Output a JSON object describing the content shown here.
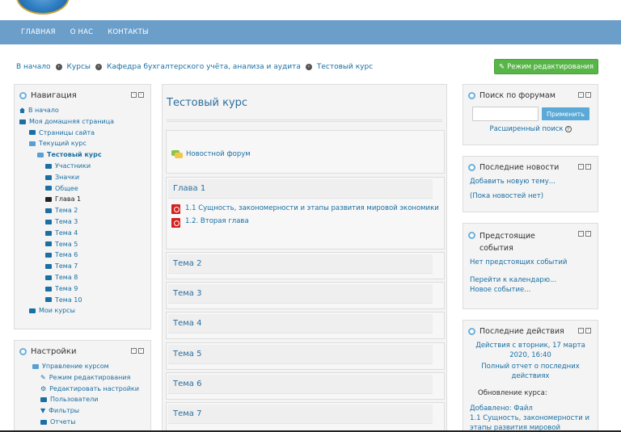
{
  "navbar": {
    "items": [
      "ГЛАВНАЯ",
      "О НАС",
      "КОНТАКТЫ"
    ]
  },
  "breadcrumb": [
    "В начало",
    "Курсы",
    "Кафедра бухгалтерского учёта, анализа и аудита",
    "Тестовый курс"
  ],
  "edit_button": "Режим редактирования",
  "navigation": {
    "title": "Навигация",
    "items": [
      {
        "label": "В начало",
        "icon": "home"
      },
      {
        "label": "Моя домашняя страница",
        "icon": "folder"
      },
      {
        "label": "Страницы сайта",
        "icon": "folder"
      },
      {
        "label": "Текущий курс",
        "icon": "folder-open"
      },
      {
        "label": "Тестовый курс",
        "icon": "folder-open"
      },
      {
        "label": "Участники",
        "icon": "folder"
      },
      {
        "label": "Значки",
        "icon": "folder"
      },
      {
        "label": "Общее",
        "icon": "folder"
      },
      {
        "label": "Глава 1",
        "icon": "folder-dark"
      },
      {
        "label": "Тема 2",
        "icon": "folder"
      },
      {
        "label": "Тема 3",
        "icon": "folder"
      },
      {
        "label": "Тема 4",
        "icon": "folder"
      },
      {
        "label": "Тема 5",
        "icon": "folder"
      },
      {
        "label": "Тема 6",
        "icon": "folder"
      },
      {
        "label": "Тема 7",
        "icon": "folder"
      },
      {
        "label": "Тема 8",
        "icon": "folder"
      },
      {
        "label": "Тема 9",
        "icon": "folder"
      },
      {
        "label": "Тема 10",
        "icon": "folder"
      },
      {
        "label": "Мои курсы",
        "icon": "folder"
      }
    ]
  },
  "settings": {
    "title": "Настройки",
    "items": [
      {
        "label": "Управление курсом",
        "icon": "folder-open"
      },
      {
        "label": "Режим редактирования",
        "icon": "pencil"
      },
      {
        "label": "Редактировать настройки",
        "icon": "gears"
      },
      {
        "label": "Пользователи",
        "icon": "folder"
      },
      {
        "label": "Фильтры",
        "icon": "filter"
      },
      {
        "label": "Отчеты",
        "icon": "folder"
      }
    ]
  },
  "course": {
    "title": "Тестовый курс",
    "news_forum": "Новостной форум",
    "sections": [
      "Глава 1",
      "Тема 2",
      "Тема 3",
      "Тема 4",
      "Тема 5",
      "Тема 6",
      "Тема 7"
    ],
    "chapter1_items": [
      "1.1 Сущность, закономерности и этапы развития мировой экономики",
      "1.2. Вторая глава"
    ]
  },
  "forum_search": {
    "title": "Поиск по форумам",
    "button": "Применить",
    "advanced": "Расширенный поиск"
  },
  "latest_news": {
    "title": "Последние новости",
    "add": "Добавить новую тему...",
    "empty": "(Пока новостей нет)"
  },
  "upcoming": {
    "title_line1": "Предстоящие",
    "title_line2": "события",
    "none": "Нет предстоящих событий",
    "calendar": "Перейти к календарю...",
    "new_event": "Новое событие..."
  },
  "recent": {
    "title": "Последние действия",
    "since_line1": "Действия с вторник, 17 марта",
    "since_line2": "2020, 16:40",
    "full_line1": "Полный отчет о последних",
    "full_line2": "действиях",
    "updates": "Обновление курса:",
    "added": "Добавлено: Файл",
    "added_item_line1": "1.1 Сущность, закономерности и",
    "added_item_line2": "этапы развития мировой"
  }
}
